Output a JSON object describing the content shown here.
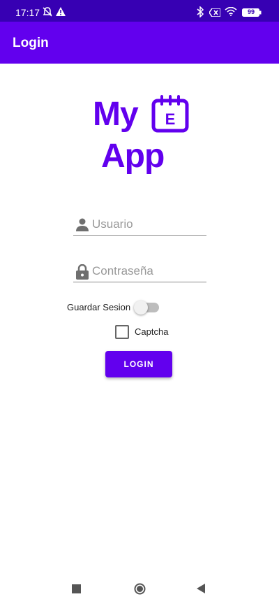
{
  "status_bar": {
    "time": "17:17",
    "battery": "99",
    "icons": [
      "bell-off-icon",
      "warning-icon",
      "bluetooth-icon",
      "x-box-icon",
      "wifi-icon",
      "battery-icon"
    ]
  },
  "toolbar": {
    "title": "Login"
  },
  "logo": {
    "line1": "My",
    "line2": "App",
    "calendar_letter": "E"
  },
  "form": {
    "username_placeholder": "Usuario",
    "password_placeholder": "Contraseña",
    "save_session_label": "Guardar Sesion",
    "save_session_on": false,
    "captcha_label": "Captcha",
    "captcha_checked": false,
    "login_button": "LOGIN"
  },
  "nav_bar": {
    "icons": [
      "recents-icon",
      "home-icon",
      "back-icon"
    ]
  },
  "colors": {
    "primary": "#6200ee",
    "primary_dark": "#3700b3"
  }
}
